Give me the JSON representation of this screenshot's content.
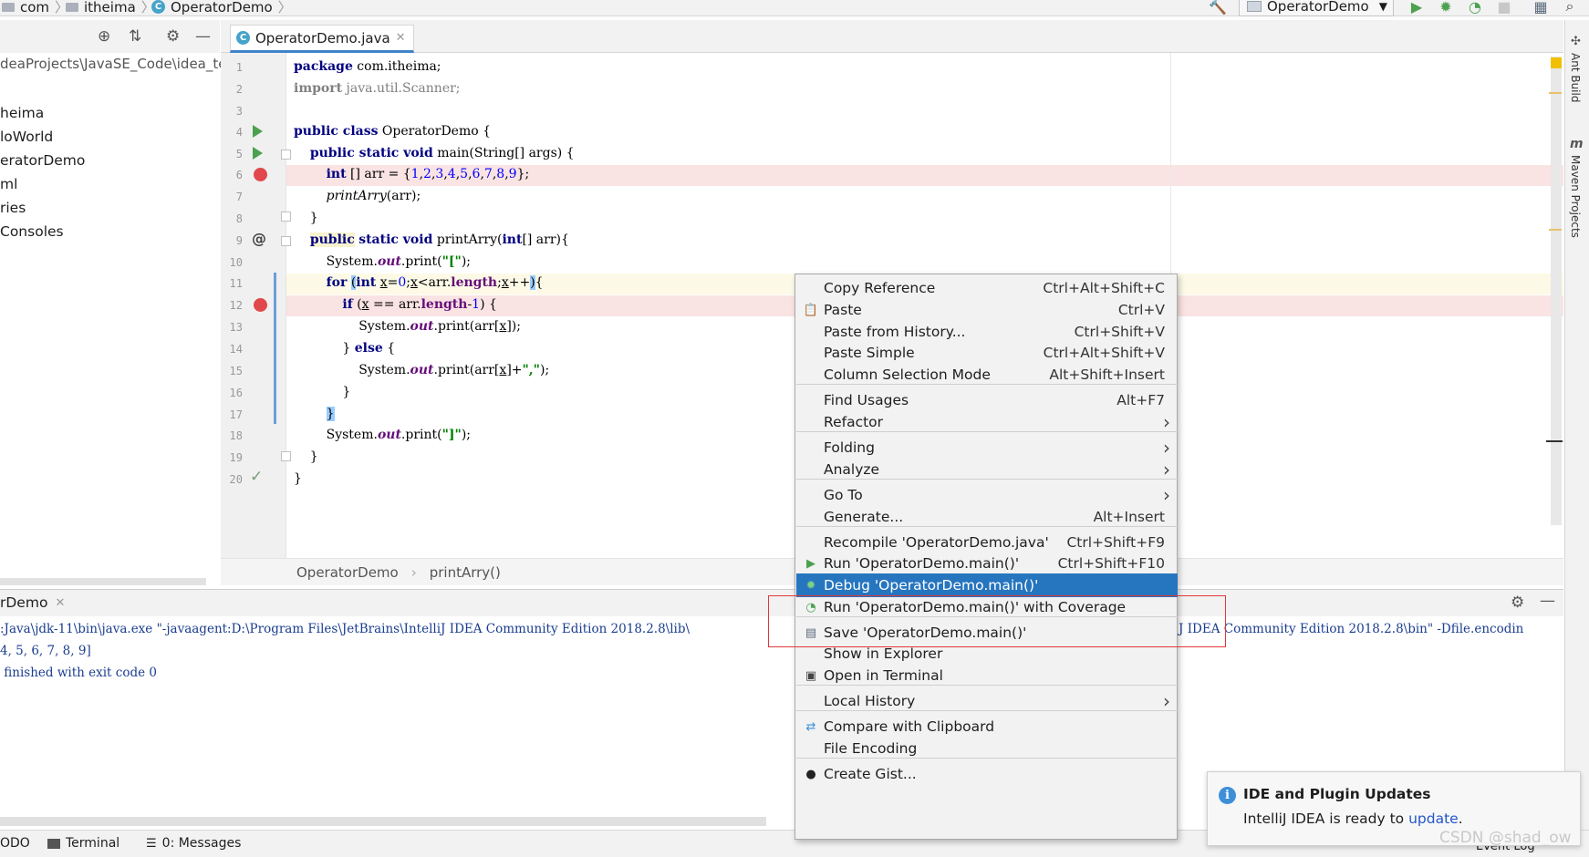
{
  "breadcrumb": {
    "items": [
      "com",
      "itheima",
      "OperatorDemo"
    ]
  },
  "toolbar": {
    "run_config": "OperatorDemo"
  },
  "project": {
    "path": "deaProjects\\JavaSE_Code\\idea_te",
    "nodes": [
      "heima",
      "loWorld",
      "eratorDemo",
      "ml",
      "ries",
      " Consoles"
    ]
  },
  "editor": {
    "tab": "OperatorDemo.java",
    "line_numbers": [
      "1",
      "2",
      "3",
      "4",
      "5",
      "6",
      "7",
      "8",
      "9",
      "10",
      "11",
      "12",
      "13",
      "14",
      "15",
      "16",
      "17",
      "18",
      "19",
      "20"
    ],
    "crumbs": [
      "OperatorDemo",
      "printArry()"
    ]
  },
  "right_tools": [
    "Ant Build",
    "Maven Projects"
  ],
  "run": {
    "tab": "rDemo",
    "console": [
      ":Java\\jdk-11\\bin\\java.exe \"-javaagent:D:\\Program Files\\JetBrains\\IntelliJ IDEA Community Edition 2018.2.8\\lib\\",
      "4, 5, 6, 7, 8, 9]",
      " finished with exit code 0"
    ],
    "console_tail": "J IDEA Community Edition 2018.2.8\\bin\" -Dfile.encodin"
  },
  "bottom_tools": [
    "ODO",
    "Terminal",
    "0: Messages"
  ],
  "context_menu": {
    "items": [
      {
        "label": "Copy Reference",
        "shortcut": "Ctrl+Alt+Shift+C"
      },
      {
        "label": "Paste",
        "shortcut": "Ctrl+V"
      },
      {
        "label": "Paste from History...",
        "shortcut": "Ctrl+Shift+V"
      },
      {
        "label": "Paste Simple",
        "shortcut": "Ctrl+Alt+Shift+V"
      },
      {
        "label": "Column Selection Mode",
        "shortcut": "Alt+Shift+Insert"
      },
      {
        "label": "Find Usages",
        "shortcut": "Alt+F7"
      },
      {
        "label": "Refactor",
        "shortcut": ""
      },
      {
        "label": "Folding",
        "shortcut": ""
      },
      {
        "label": "Analyze",
        "shortcut": ""
      },
      {
        "label": "Go To",
        "shortcut": ""
      },
      {
        "label": "Generate...",
        "shortcut": "Alt+Insert"
      },
      {
        "label": "Recompile 'OperatorDemo.java'",
        "shortcut": "Ctrl+Shift+F9"
      },
      {
        "label": "Run 'OperatorDemo.main()'",
        "shortcut": "Ctrl+Shift+F10"
      },
      {
        "label": "Debug 'OperatorDemo.main()'",
        "shortcut": ""
      },
      {
        "label": "Run 'OperatorDemo.main()' with Coverage",
        "shortcut": ""
      },
      {
        "label": "Save 'OperatorDemo.main()'",
        "shortcut": ""
      },
      {
        "label": "Show in Explorer",
        "shortcut": ""
      },
      {
        "label": "Open in Terminal",
        "shortcut": ""
      },
      {
        "label": "Local History",
        "shortcut": ""
      },
      {
        "label": "Compare with Clipboard",
        "shortcut": ""
      },
      {
        "label": "File Encoding",
        "shortcut": ""
      },
      {
        "label": "Create Gist...",
        "shortcut": ""
      }
    ],
    "selected": "Debug 'OperatorDemo.main()'"
  },
  "notification": {
    "title": "IDE and Plugin Updates",
    "body": "IntelliJ IDEA is ready to",
    "link": "update",
    "trailing": "."
  },
  "status": {
    "event_log": "Event Log"
  },
  "watermark": "CSDN @shad_ow"
}
